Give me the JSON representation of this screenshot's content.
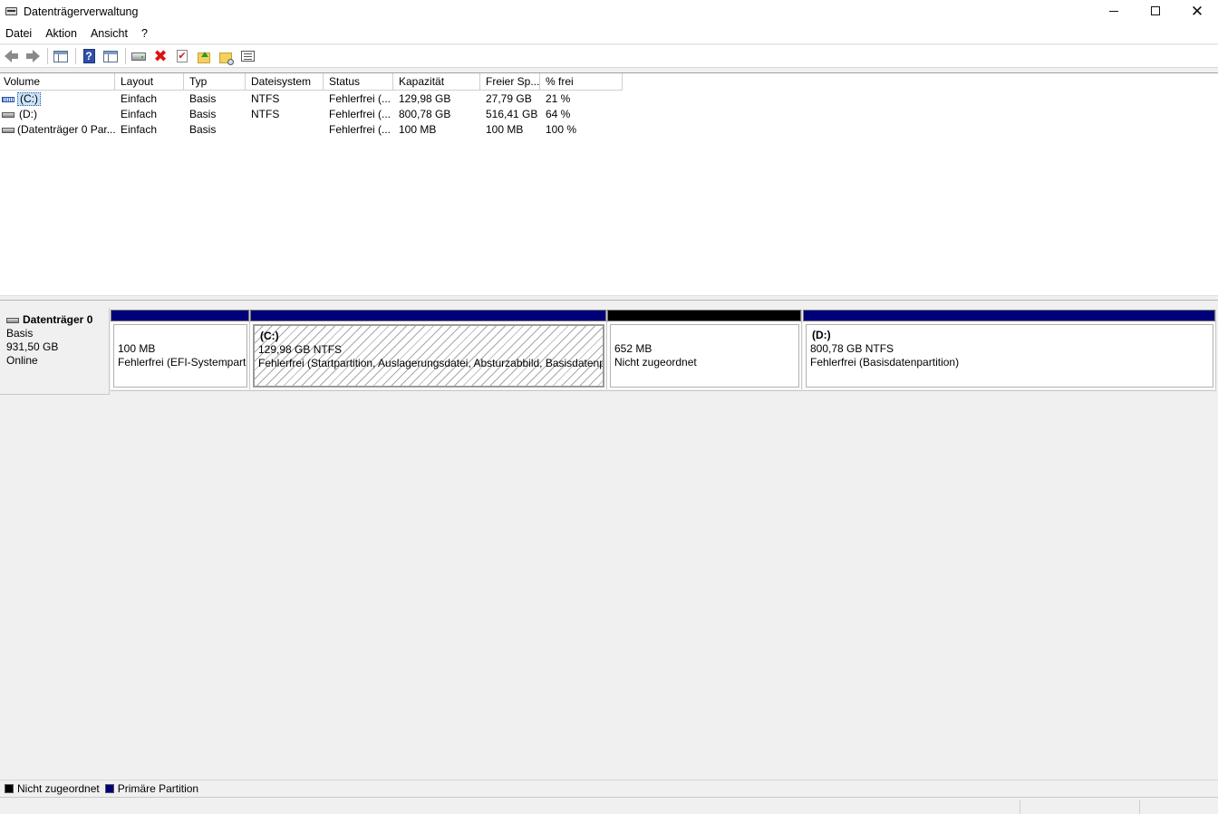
{
  "window": {
    "title": "Datenträgerverwaltung",
    "controls": [
      "minimize",
      "maximize",
      "close"
    ]
  },
  "menu": {
    "items": [
      {
        "label": "Datei"
      },
      {
        "label": "Aktion"
      },
      {
        "label": "Ansicht"
      },
      {
        "label": "?"
      }
    ]
  },
  "toolbar": {
    "icons": [
      "back-arrow-icon",
      "forward-arrow-icon",
      "show-hide-console-tree-icon",
      "help-icon",
      "properties-panel-icon",
      "connect-drive-icon",
      "delete-icon",
      "check-icon",
      "folder-up-icon",
      "folder-search-icon",
      "list-view-icon"
    ]
  },
  "volume_list": {
    "columns": [
      "Volume",
      "Layout",
      "Typ",
      "Dateisystem",
      "Status",
      "Kapazität",
      "Freier Sp...",
      "% frei"
    ],
    "rows": [
      {
        "volume": "(C:)",
        "layout": "Einfach",
        "typ": "Basis",
        "dateisystem": "NTFS",
        "status": "Fehlerfrei (...",
        "kapazitaet": "129,98 GB",
        "frei": "27,79 GB",
        "prozent": "21 %",
        "selected": true
      },
      {
        "volume": "(D:)",
        "layout": "Einfach",
        "typ": "Basis",
        "dateisystem": "NTFS",
        "status": "Fehlerfrei (...",
        "kapazitaet": "800,78 GB",
        "frei": "516,41 GB",
        "prozent": "64 %",
        "selected": false
      },
      {
        "volume": "(Datenträger 0 Par...",
        "layout": "Einfach",
        "typ": "Basis",
        "dateisystem": "",
        "status": "Fehlerfrei (...",
        "kapazitaet": "100 MB",
        "frei": "100 MB",
        "prozent": "100 %",
        "selected": false
      }
    ]
  },
  "disk": {
    "name": "Datenträger 0",
    "type": "Basis",
    "size": "931,50 GB",
    "state": "Online",
    "partitions": [
      {
        "title": "",
        "size_line": "100 MB",
        "status_line": "Fehlerfrei (EFI-Systemparti",
        "kind": "primary"
      },
      {
        "title": "(C:)",
        "size_line": "129,98 GB NTFS",
        "status_line": "Fehlerfrei (Startpartition, Auslagerungsdatei, Absturzabbild, Basisdatenp",
        "kind": "primary"
      },
      {
        "title": "",
        "size_line": "652 MB",
        "status_line": "Nicht zugeordnet",
        "kind": "unallocated"
      },
      {
        "title": "(D:)",
        "size_line": "800,78 GB NTFS",
        "status_line": "Fehlerfrei (Basisdatenpartition)",
        "kind": "primary"
      }
    ]
  },
  "legend": {
    "items": [
      {
        "label": "Nicht zugeordnet",
        "color": "#000000"
      },
      {
        "label": "Primäre Partition",
        "color": "#00007b"
      }
    ]
  },
  "colors": {
    "primary_partition": "#00007b",
    "unallocated": "#000000",
    "selection": "#cce4f7"
  }
}
